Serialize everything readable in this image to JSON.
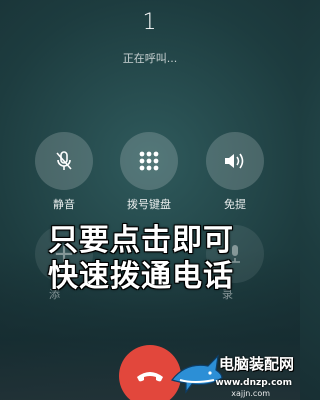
{
  "call": {
    "caller_number": "1",
    "status_text": "正在呼叫..."
  },
  "controls": [
    {
      "label": "静音",
      "icon": "mic-mute-icon"
    },
    {
      "label": "拨号键盘",
      "icon": "keypad-icon"
    },
    {
      "label": "免提",
      "icon": "speaker-icon"
    }
  ],
  "controls_row2": [
    {
      "label": "添",
      "icon": "add-call-icon"
    },
    {
      "label": "录",
      "icon": "record-icon"
    }
  ],
  "overlay": {
    "line1": "只要点击即可",
    "line2": "快速拨通电话"
  },
  "hangup": {
    "icon": "phone-hangup-icon",
    "color": "#e2473c"
  },
  "watermark": {
    "text": "电脑装配网",
    "url": "www.dnzp.com",
    "url2": "xajjn.com"
  }
}
